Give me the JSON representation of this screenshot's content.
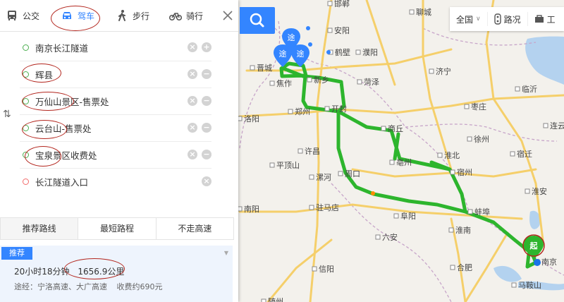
{
  "modes": [
    {
      "label": "公交",
      "icon": "bus-icon"
    },
    {
      "label": "驾车",
      "icon": "car-icon"
    },
    {
      "label": "步行",
      "icon": "walk-icon"
    },
    {
      "label": "骑行",
      "icon": "bike-icon"
    }
  ],
  "stops": [
    "南京长江隧道",
    "辉县",
    "万仙山景区-售票处",
    "云台山-售票处",
    "宝泉景区收费处",
    "长江隧道入口"
  ],
  "swap_symbol": "⇅",
  "route_tabs": [
    "推荐路线",
    "最短路程",
    "不走高速"
  ],
  "result": {
    "tag": "推荐",
    "duration": "20小时18分钟",
    "distance": "1656.9公里",
    "via": "途经：宁洛高速、大广高速",
    "toll": "收费约690元"
  },
  "toolbar": {
    "region": "全国",
    "traffic": "路况",
    "tools": "工"
  },
  "map": {
    "route_color": "#2db52d",
    "cities": [
      {
        "name": "邯郸"
      },
      {
        "name": "聊城"
      },
      {
        "name": "安阳"
      },
      {
        "name": "鹤壁"
      },
      {
        "name": "濮阳"
      },
      {
        "name": "晋城"
      },
      {
        "name": "新乡"
      },
      {
        "name": "济宁"
      },
      {
        "name": "焦作"
      },
      {
        "name": "菏泽"
      },
      {
        "name": "临沂"
      },
      {
        "name": "郑州"
      },
      {
        "name": "开封"
      },
      {
        "name": "枣庄"
      },
      {
        "name": "洛阳"
      },
      {
        "name": "商丘"
      },
      {
        "name": "徐州"
      },
      {
        "name": "淮北"
      },
      {
        "name": "宿迁"
      },
      {
        "name": "许昌"
      },
      {
        "name": "平顶山"
      },
      {
        "name": "亳州"
      },
      {
        "name": "宿州"
      },
      {
        "name": "漯河"
      },
      {
        "name": "周口"
      },
      {
        "name": "淮安"
      },
      {
        "name": "南阳"
      },
      {
        "name": "驻马店"
      },
      {
        "name": "阜阳"
      },
      {
        "name": "蚌埠"
      },
      {
        "name": "淮南"
      },
      {
        "name": "六安"
      },
      {
        "name": "合肥"
      },
      {
        "name": "信阳"
      },
      {
        "name": "随州"
      },
      {
        "name": "马鞍山"
      },
      {
        "name": "南京"
      },
      {
        "name": "连云港"
      }
    ],
    "markers": {
      "via": "途",
      "start": "起"
    }
  }
}
